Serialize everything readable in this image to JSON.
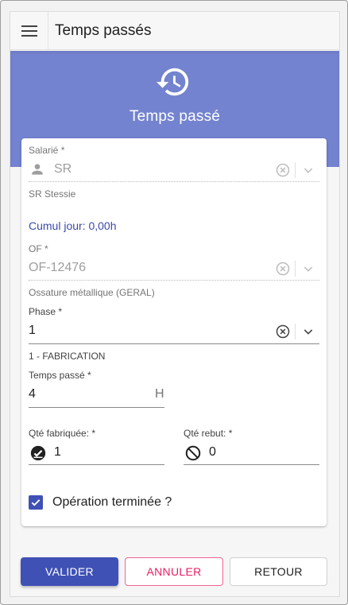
{
  "appbar": {
    "title": "Temps passés",
    "menu_icon": "menu-icon"
  },
  "banner": {
    "title": "Temps passé",
    "icon": "history-icon"
  },
  "salarie": {
    "label": "Salarié *",
    "value": "SR",
    "hint": "SR  Stessie"
  },
  "cumul": {
    "text": "Cumul jour: 0,00h"
  },
  "of": {
    "label": "OF *",
    "value": "OF-12476",
    "hint": "Ossature métallique (GERAL)"
  },
  "phase": {
    "label": "Phase *",
    "value": "1",
    "hint": "1 - FABRICATION"
  },
  "temps": {
    "label": "Temps passé *",
    "value": "4",
    "suffix": "H"
  },
  "qte_fab": {
    "label": "Qté fabriquée: *",
    "value": "1"
  },
  "qte_rebut": {
    "label": "Qté rebut: *",
    "value": "0"
  },
  "operation": {
    "label": "Opération terminée ?",
    "checked": true
  },
  "buttons": {
    "valider": "VALIDER",
    "annuler": "ANNULER",
    "retour": "RETOUR"
  },
  "colors": {
    "primary": "#3f51b5",
    "banner": "#7383cf",
    "cancel": "#e91e63",
    "link": "#3949ab"
  }
}
